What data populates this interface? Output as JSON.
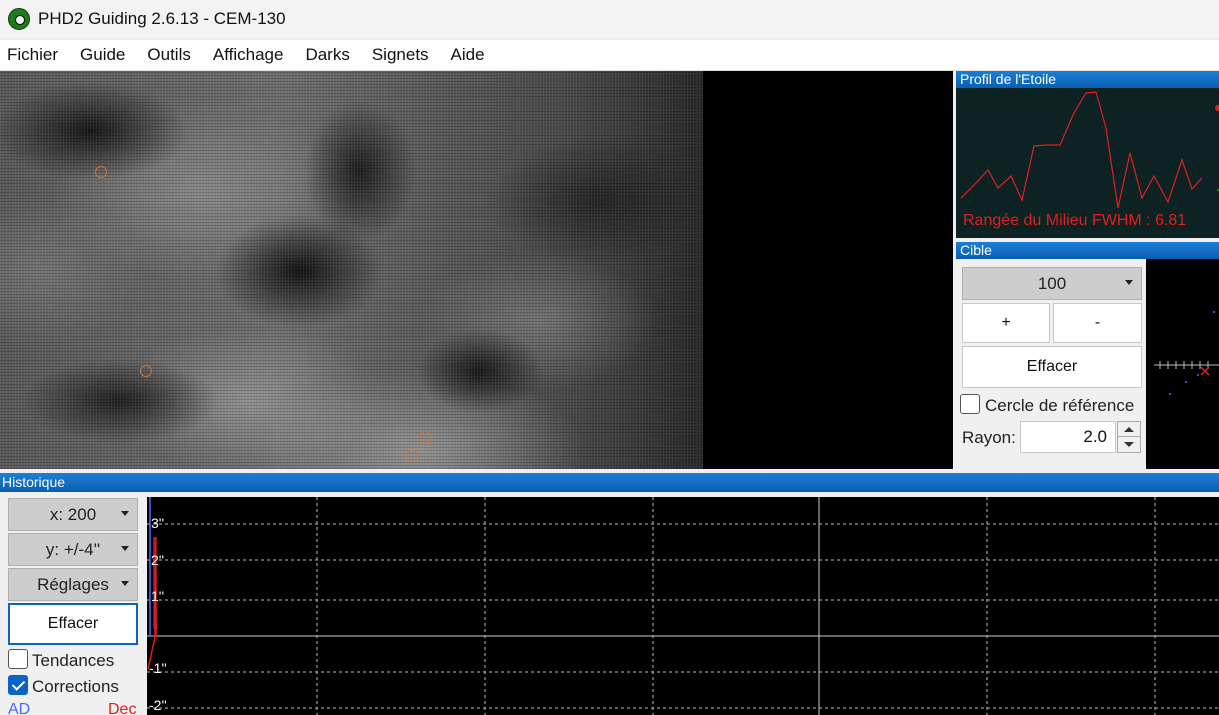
{
  "window": {
    "title": "PHD2 Guiding 2.6.13 - CEM-130"
  },
  "menu": [
    "Fichier",
    "Guide",
    "Outils",
    "Affichage",
    "Darks",
    "Signets",
    "Aide"
  ],
  "profile": {
    "header": "Profil de l'Etoile",
    "label": "Rangée du Milieu FWHM : 6.81",
    "line_color": "#e02020"
  },
  "target": {
    "header": "Cible",
    "zoom_value": "100",
    "plus_label": "+",
    "minus_label": "-",
    "clear_label": "Effacer",
    "ref_circle_label": "Cercle de référence",
    "ref_circle_checked": false,
    "radius_label": "Rayon:",
    "radius_value": "2.0"
  },
  "history": {
    "header": "Historique",
    "x_scale": "x: 200",
    "y_scale": "y: +/-4''",
    "settings_label": "Réglages",
    "clear_label": "Effacer",
    "trends_label": "Tendances",
    "trends_checked": false,
    "corrections_label": "Corrections",
    "corrections_checked": true,
    "legend_ad": "AD",
    "legend_dec": "Dec",
    "y_labels": [
      "3''",
      "2''",
      "1''",
      "-1''",
      "-2''"
    ],
    "ad_color": "#4a6cff",
    "dec_color": "#e02020"
  }
}
